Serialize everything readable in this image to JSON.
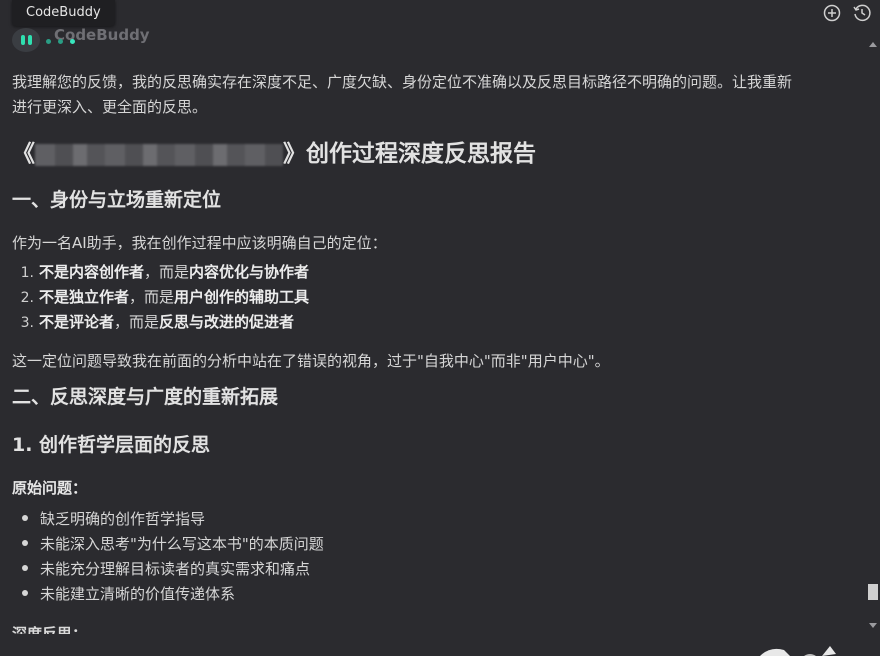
{
  "app": {
    "tab_title": "CodeBuddy",
    "agent_name": "CodeBuddy",
    "icons": {
      "new_chat": "plus-circle-icon",
      "history": "history-icon"
    },
    "colors": {
      "background": "#2b2b2f",
      "accent": "#39e7bf"
    }
  },
  "message": {
    "intro_line1": "我理解您的反馈，我的反思确实存在深度不足、广度欠缺、身份定位不准确以及反思目标路径不明确的问题。让我重新",
    "intro_line2": "进行更深入、更全面的反思。",
    "report_title_open": "《",
    "report_title_close": "》创作过程深度反思报告",
    "section1_heading": "一、身份与立场重新定位",
    "section1_intro": "作为一名AI助手，我在创作过程中应该明确自己的定位：",
    "positioning": [
      {
        "num": "1.",
        "bold_a": "不是内容创作者",
        "mid": "，而是",
        "bold_b": "内容优化与协作者"
      },
      {
        "num": "2.",
        "bold_a": "不是独立作者",
        "mid": "，而是",
        "bold_b": "用户创作的辅助工具"
      },
      {
        "num": "3.",
        "bold_a": "不是评论者",
        "mid": "，而是",
        "bold_b": "反思与改进的促进者"
      }
    ],
    "section1_conclusion": "这一定位问题导致我在前面的分析中站在了错误的视角，过于\"自我中心\"而非\"用户中心\"。",
    "section2_heading": "二、反思深度与广度的重新拓展",
    "subsection_heading": "1. 创作哲学层面的反思",
    "original_problems_label": "原始问题：",
    "original_problems": [
      "缺乏明确的创作哲学指导",
      "未能深入思考\"为什么写这本书\"的本质问题",
      "未能充分理解目标读者的真实需求和痛点",
      "未能建立清晰的价值传递体系"
    ],
    "depth_label": "深度反思："
  }
}
